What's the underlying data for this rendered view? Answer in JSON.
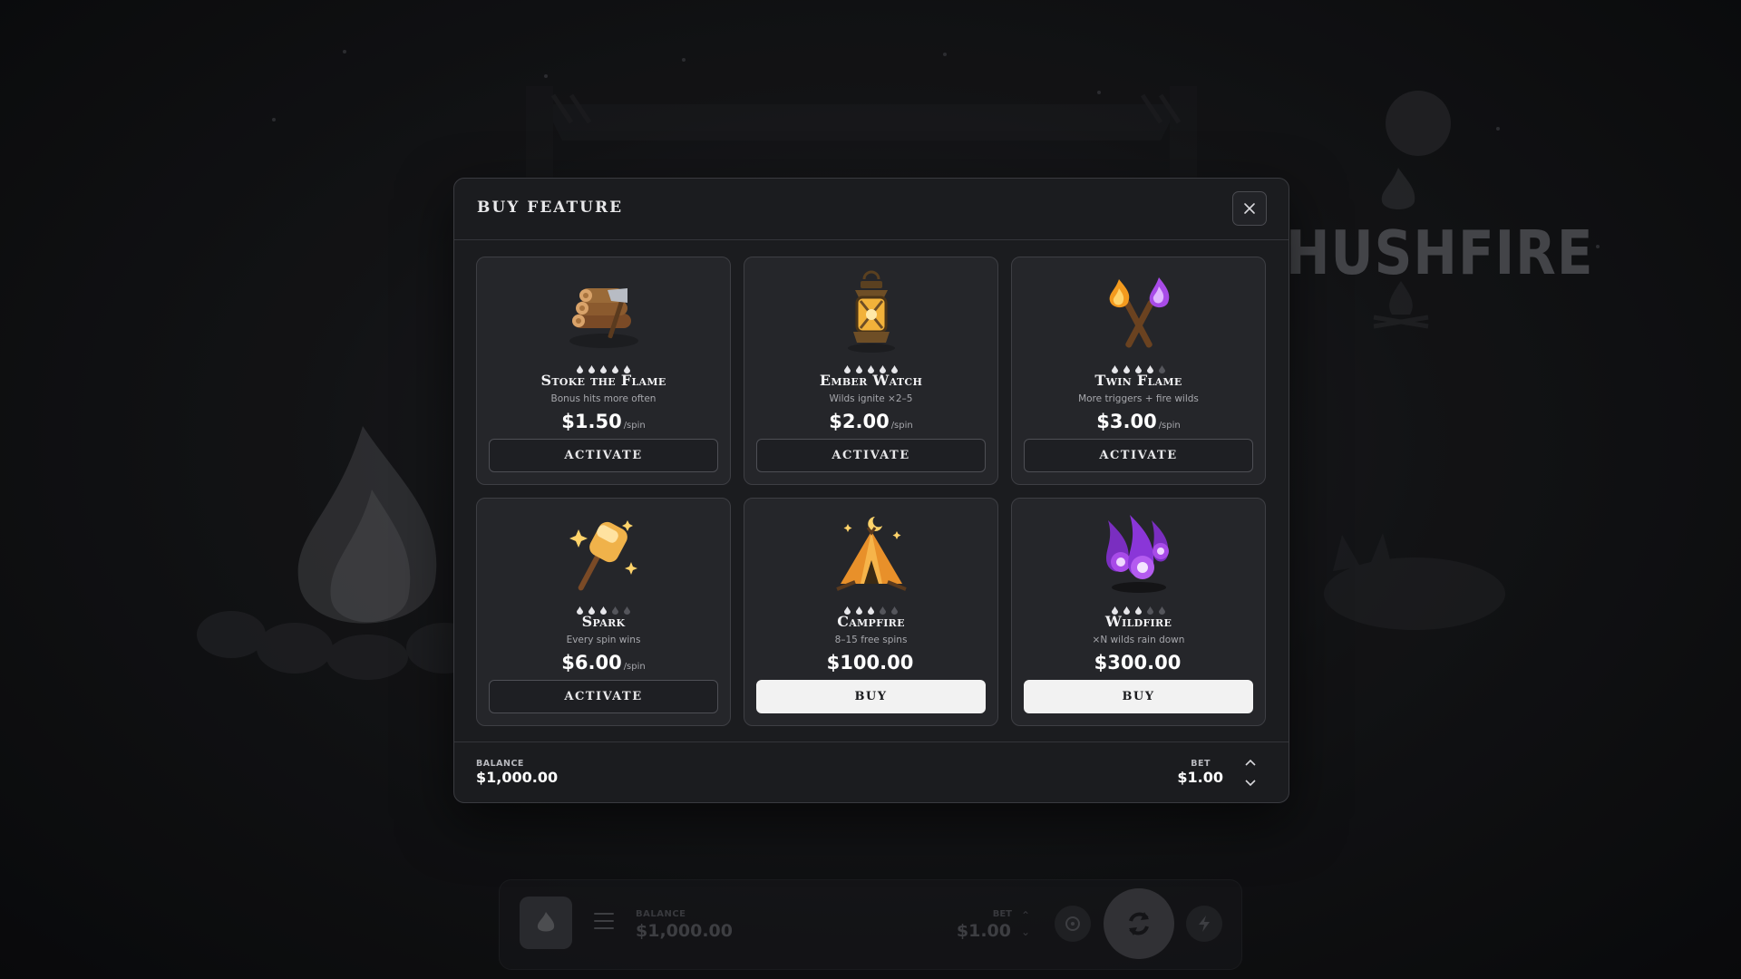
{
  "background": {
    "game_logo": "HUSHFIRE"
  },
  "bottom_bar": {
    "balance_label": "BALANCE",
    "balance_value": "$1,000.00",
    "bet_label": "BET",
    "bet_value": "$1.00"
  },
  "modal": {
    "title": "BUY FEATURE",
    "cards": [
      {
        "name": "Stoke the Flame",
        "description": "Bonus hits more often",
        "price": "$1.50",
        "per": "/spin",
        "button": "ACTIVATE",
        "button_style": "outline",
        "rating": 5,
        "rating_max": 5,
        "icon": "firewood-axe-icon"
      },
      {
        "name": "Ember Watch",
        "description": "Wilds ignite ×2–5",
        "price": "$2.00",
        "per": "/spin",
        "button": "ACTIVATE",
        "button_style": "outline",
        "rating": 5,
        "rating_max": 5,
        "icon": "lantern-icon"
      },
      {
        "name": "Twin Flame",
        "description": "More triggers + fire wilds",
        "price": "$3.00",
        "per": "/spin",
        "button": "ACTIVATE",
        "button_style": "outline",
        "rating": 4,
        "rating_max": 5,
        "icon": "crossed-torches-icon"
      },
      {
        "name": "Spark",
        "description": "Every spin wins",
        "price": "$6.00",
        "per": "/spin",
        "button": "ACTIVATE",
        "button_style": "outline",
        "rating": 3,
        "rating_max": 5,
        "icon": "marshmallow-stick-icon"
      },
      {
        "name": "Campfire",
        "description": "8–15 free spins",
        "price": "$100.00",
        "per": "",
        "button": "BUY",
        "button_style": "filled",
        "rating": 3,
        "rating_max": 5,
        "icon": "campfire-tent-icon"
      },
      {
        "name": "Wildfire",
        "description": "×N wilds rain down",
        "price": "$300.00",
        "per": "",
        "button": "BUY",
        "button_style": "filled",
        "rating": 3,
        "rating_max": 5,
        "icon": "purple-fireballs-icon"
      }
    ],
    "footer": {
      "balance_label": "BALANCE",
      "balance_value": "$1,000.00",
      "bet_label": "BET",
      "bet_value": "$1.00"
    }
  },
  "colors": {
    "page_bg": "#101114",
    "modal_bg": "#1b1c1f",
    "card_bg": "#25262a",
    "buy_button_bg": "#f2f2f2",
    "flame_orange": "#f39a1e",
    "flame_purple": "#a84be8"
  }
}
